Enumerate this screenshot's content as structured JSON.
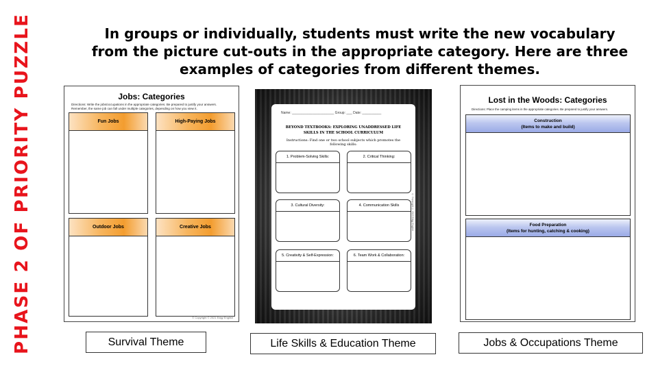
{
  "side_title": "PHASE 2 OF PRIORITY PUZZLE",
  "headline": {
    "line1": "In groups or individually,  students must write the new vocabulary",
    "line2": "from the picture cut-outs in the appropriate  category. Here are three",
    "line3": "examples of categories from different themes."
  },
  "jobs_sheet": {
    "title": "Jobs: Categories",
    "directions_1": "Directions: Write the jobs/occupations in the appropriate categories. Be prepared to justify your answers.",
    "directions_2": "Remember, the same job can fall under multiple categories, depending on how you view it.",
    "categories": [
      "Fun Jobs",
      "High-Paying Jobs",
      "Outdoor Jobs",
      "Creative Jobs"
    ],
    "footer": "© Copyright © 2021 Edgy English"
  },
  "life_skills_sheet": {
    "header_line": "Name: ______________________   Group: ___   Date: __________",
    "title_1": "BEYOND TEXTBOOKS: EXPLORING UNADDRESSED LIFE",
    "title_2": "SKILLS IN THE SCHOOL CURRICULUM",
    "instructions": "Instructions: Find one or two  school subjects which promotes the following skills:",
    "skills": [
      "1. Problem-Solving Skills:",
      "2. Critical Thinking:",
      "3. Cultural Diversity:",
      "4. Communication Skills",
      "5. Creativity & Self-Expression:",
      "6. Team Work & Collaboration:"
    ],
    "side_copyright": "© Copyright © 2023 Edgy English"
  },
  "woods_sheet": {
    "title": "Lost in the Woods: Categories",
    "directions": "Directions: Place the camping items in the appropriate categories. Be prepared to justify your answers.",
    "categories": [
      {
        "name": "Construction",
        "sub": "(Items to make and build)"
      },
      {
        "name": "Food Preparation",
        "sub": "(Items for hunting, catching & cooking)"
      }
    ]
  },
  "captions": [
    "Survival Theme",
    "Life Skills & Education Theme",
    "Jobs & Occupations Theme"
  ],
  "colors": {
    "side_title": "#e8141c",
    "jobs_header": "#f39d2f",
    "woods_header": "#9aaae6"
  }
}
